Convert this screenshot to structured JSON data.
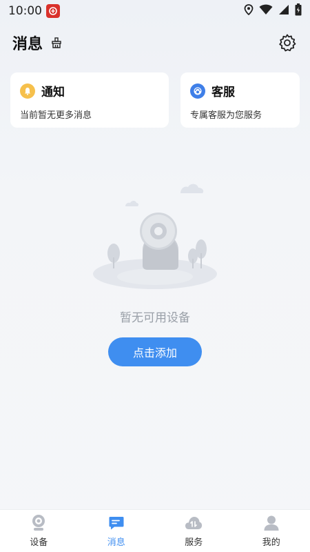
{
  "status_bar": {
    "time": "10:00",
    "icons": [
      "app-notification-icon",
      "location-icon",
      "wifi-icon",
      "signal-icon",
      "battery-icon"
    ]
  },
  "header": {
    "title": "消息",
    "icons": [
      "clean-icon",
      "settings-icon"
    ]
  },
  "cards": [
    {
      "title": "通知",
      "desc": "当前暂无更多消息",
      "icon": "bell-icon",
      "color": "#f6c04c"
    },
    {
      "title": "客服",
      "desc": "专属客服为您服务",
      "icon": "service-icon",
      "color": "#3f7fe8"
    }
  ],
  "empty_state": {
    "text": "暂无可用设备",
    "button_label": "点击添加"
  },
  "bottom_nav": {
    "active_index": 1,
    "items": [
      {
        "label": "设备",
        "icon": "camera-icon"
      },
      {
        "label": "消息",
        "icon": "message-icon"
      },
      {
        "label": "服务",
        "icon": "cloud-service-icon"
      },
      {
        "label": "我的",
        "icon": "profile-icon"
      }
    ]
  },
  "colors": {
    "accent": "#3f8ef0",
    "notice_icon": "#f6c04c",
    "service_icon": "#3f7fe8",
    "muted_text": "#9aa0a8"
  }
}
